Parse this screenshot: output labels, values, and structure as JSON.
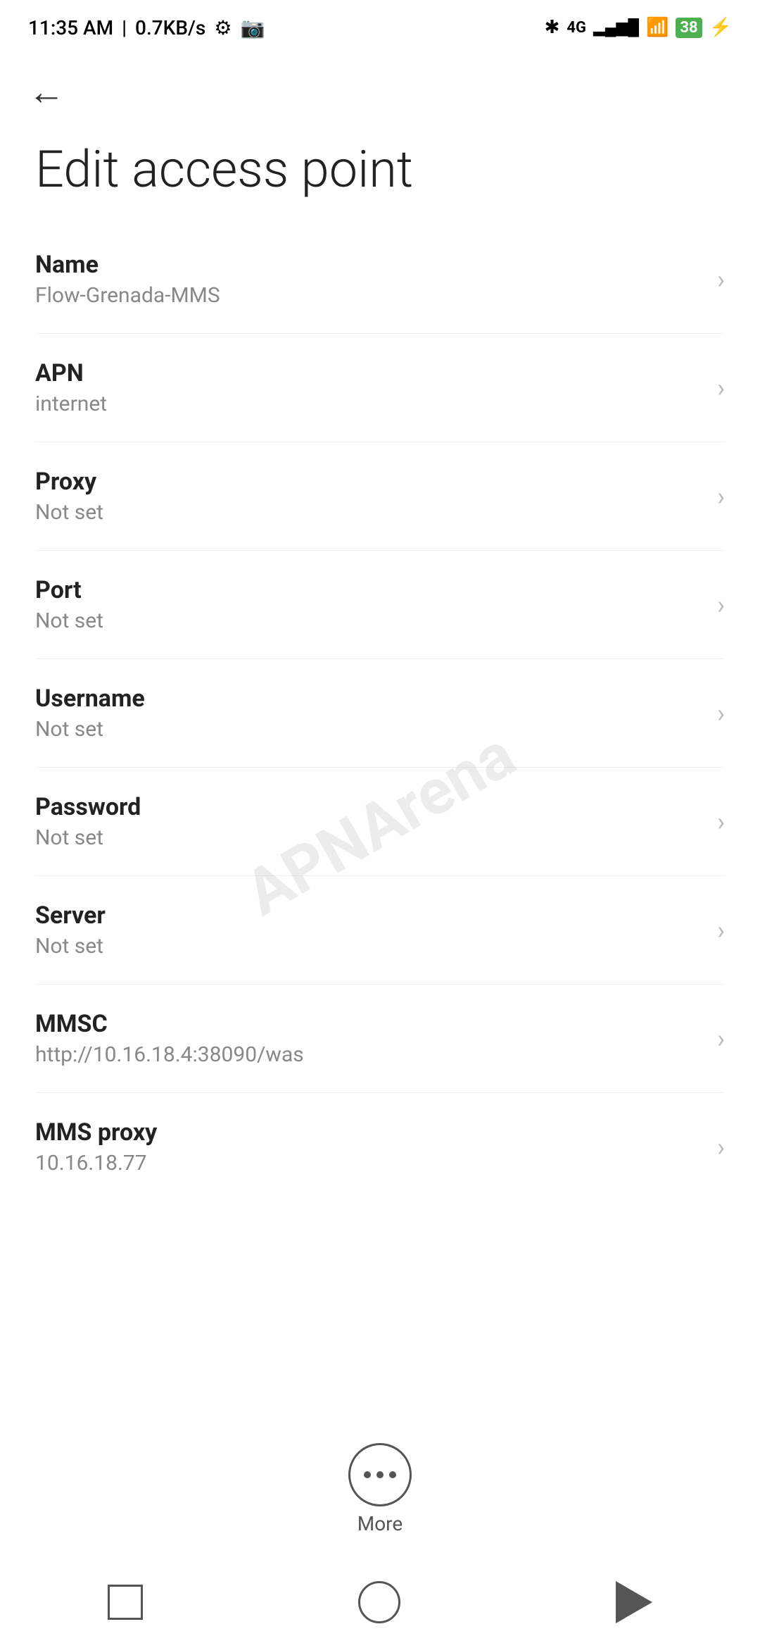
{
  "status_bar": {
    "time": "11:35 AM",
    "speed": "0.7KB/s"
  },
  "header": {
    "back_label": "←",
    "title": "Edit access point"
  },
  "settings": {
    "items": [
      {
        "label": "Name",
        "value": "Flow-Grenada-MMS"
      },
      {
        "label": "APN",
        "value": "internet"
      },
      {
        "label": "Proxy",
        "value": "Not set"
      },
      {
        "label": "Port",
        "value": "Not set"
      },
      {
        "label": "Username",
        "value": "Not set"
      },
      {
        "label": "Password",
        "value": "Not set"
      },
      {
        "label": "Server",
        "value": "Not set"
      },
      {
        "label": "MMSC",
        "value": "http://10.16.18.4:38090/was"
      },
      {
        "label": "MMS proxy",
        "value": "10.16.18.77"
      }
    ]
  },
  "more_button": {
    "label": "More"
  },
  "watermark": "APNArena"
}
